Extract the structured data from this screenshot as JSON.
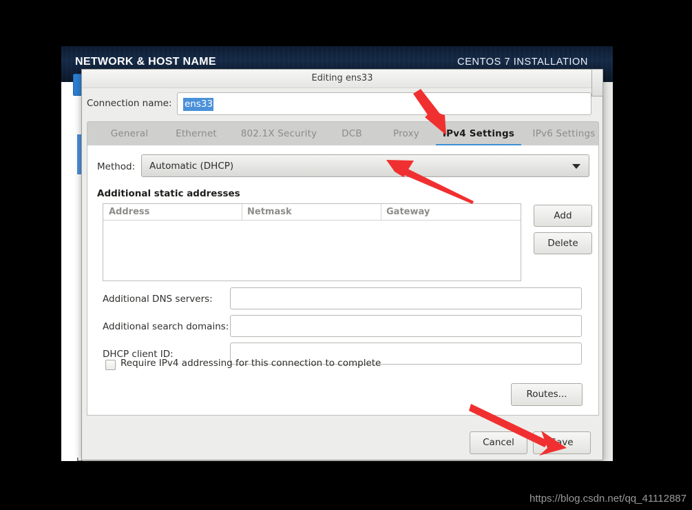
{
  "installer": {
    "title": "NETWORK & HOST NAME",
    "subtitle": "CENTOS 7 INSTALLATION",
    "hostname_label_partial": "H"
  },
  "dialog": {
    "title": "Editing ens33",
    "connection_name_label": "Connection name:",
    "connection_name_value": "ens33",
    "tabs": [
      {
        "label": "General",
        "active": false
      },
      {
        "label": "Ethernet",
        "active": false
      },
      {
        "label": "802.1X Security",
        "active": false
      },
      {
        "label": "DCB",
        "active": false
      },
      {
        "label": "Proxy",
        "active": false
      },
      {
        "label": "IPv4 Settings",
        "active": true
      },
      {
        "label": "IPv6 Settings",
        "active": false
      }
    ],
    "method_label": "Method:",
    "method_value": "Automatic (DHCP)",
    "section_title": "Additional static addresses",
    "address_table": {
      "columns": [
        "Address",
        "Netmask",
        "Gateway"
      ],
      "rows": []
    },
    "add_button": "Add",
    "delete_button": "Delete",
    "fields": [
      {
        "label": "Additional DNS servers:",
        "value": "",
        "placeholder": ""
      },
      {
        "label": "Additional search domains:",
        "value": "",
        "placeholder": ""
      },
      {
        "label": "DHCP client ID:",
        "value": "",
        "placeholder": ""
      }
    ],
    "checkbox_label": "Require IPv4 addressing for this connection to complete",
    "checkbox_checked": false,
    "routes_button": "Routes...",
    "cancel_button": "Cancel",
    "save_button": "Save"
  },
  "annotations": {
    "arrow_color": "#f03030",
    "arrows": [
      {
        "name": "arrow-to-ipv4-tab",
        "points_to": "IPv4 Settings"
      },
      {
        "name": "arrow-to-method-dropdown",
        "points_to": "Automatic (DHCP)"
      },
      {
        "name": "arrow-to-save-button",
        "points_to": "Save"
      }
    ]
  },
  "watermark": "https://blog.csdn.net/qq_41112887",
  "colors": {
    "header_navy": "#0d1b30",
    "accent_blue": "#3b8fd4",
    "selection_blue": "#4a90d9",
    "arrow_red": "#f03030",
    "dialog_bg": "#ededeb"
  }
}
